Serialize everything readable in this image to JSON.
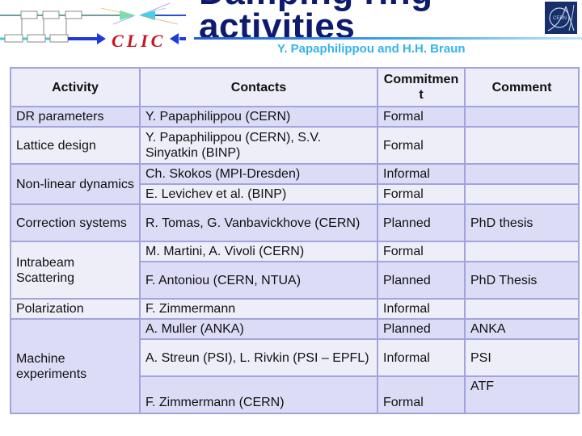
{
  "header": {
    "title_line1": "Damping ring",
    "title_line2": "activities",
    "subtitle": "Y. Papaphilippou and H.H. Braun",
    "clic_logo_text": "CLIC",
    "colors": {
      "title": "#0d1a6e",
      "subtitle": "#33b4ea",
      "clic_text": "#c8141e",
      "table_border": "#a3a3dd",
      "row_dark": "#dcdcf6",
      "row_light": "#eeeef9"
    }
  },
  "table": {
    "columns": [
      "Activity",
      "Contacts",
      "Commitmen\nt",
      "Comment"
    ],
    "rows": [
      {
        "activity": "DR parameters",
        "contact": "Y. Papaphilippou (CERN)",
        "commitment": "Formal",
        "comment": ""
      },
      {
        "activity": "Lattice design",
        "contact": "Y. Papaphilippou (CERN), S.V. Sinyatkin (BINP)",
        "commitment": "Formal",
        "comment": ""
      },
      {
        "activity": "Non-linear dynamics",
        "contact": "Ch. Skokos (MPI-Dresden)",
        "commitment": "Informal",
        "comment": ""
      },
      {
        "activity": "",
        "contact": "E. Levichev et al. (BINP)",
        "commitment": "Formal",
        "comment": ""
      },
      {
        "activity": "Correction systems",
        "contact": "R. Tomas, G. Vanbavickhove (CERN)",
        "commitment": "Planned",
        "comment": "PhD thesis"
      },
      {
        "activity": "Intrabeam Scattering",
        "contact": "M. Martini, A. Vivoli (CERN)",
        "commitment": "Formal",
        "comment": ""
      },
      {
        "activity": "",
        "contact": "F. Antoniou (CERN, NTUA)",
        "commitment": "Planned",
        "comment": "PhD Thesis"
      },
      {
        "activity": "Polarization",
        "contact": "F. Zimmermann",
        "commitment": "Informal",
        "comment": ""
      },
      {
        "activity": "Machine experiments",
        "contact": "A. Muller (ANKA)",
        "commitment": "Planned",
        "comment": "ANKA"
      },
      {
        "activity": "",
        "contact": "A. Streun (PSI), L. Rivkin (PSI – EPFL)",
        "commitment": "Informal",
        "comment": "PSI"
      },
      {
        "activity": "",
        "contact": "F. Zimmermann (CERN)",
        "commitment": "Formal",
        "comment": "ATF"
      }
    ]
  }
}
